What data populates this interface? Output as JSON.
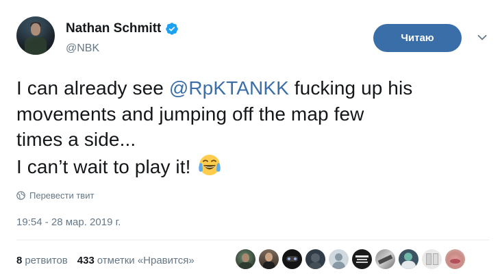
{
  "author": {
    "name": "Nathan Schmitt",
    "handle": "@NBK",
    "verified": true
  },
  "follow_button": {
    "label": "Читаю"
  },
  "tweet": {
    "line1_prefix": "I can already see ",
    "mention": "@RpKTANKK",
    "line1_suffix": " fucking up his",
    "line2": "movements and jumping off the map few",
    "line3": "times a side...",
    "line4": "I can’t wait to play it! ",
    "emoji": "face-with-tears-of-joy"
  },
  "translate_label": "Перевести твит",
  "timestamp": "19:54 - 28 мар. 2019 г.",
  "stats": {
    "retweets_count": "8",
    "retweets_label": "ретвитов",
    "likes_count": "433",
    "likes_label": "отметки «Нравится»"
  },
  "colors": {
    "accent": "#3a6ea8",
    "text": "#14171a",
    "secondary": "#657786",
    "verified": "#1da1f2"
  }
}
